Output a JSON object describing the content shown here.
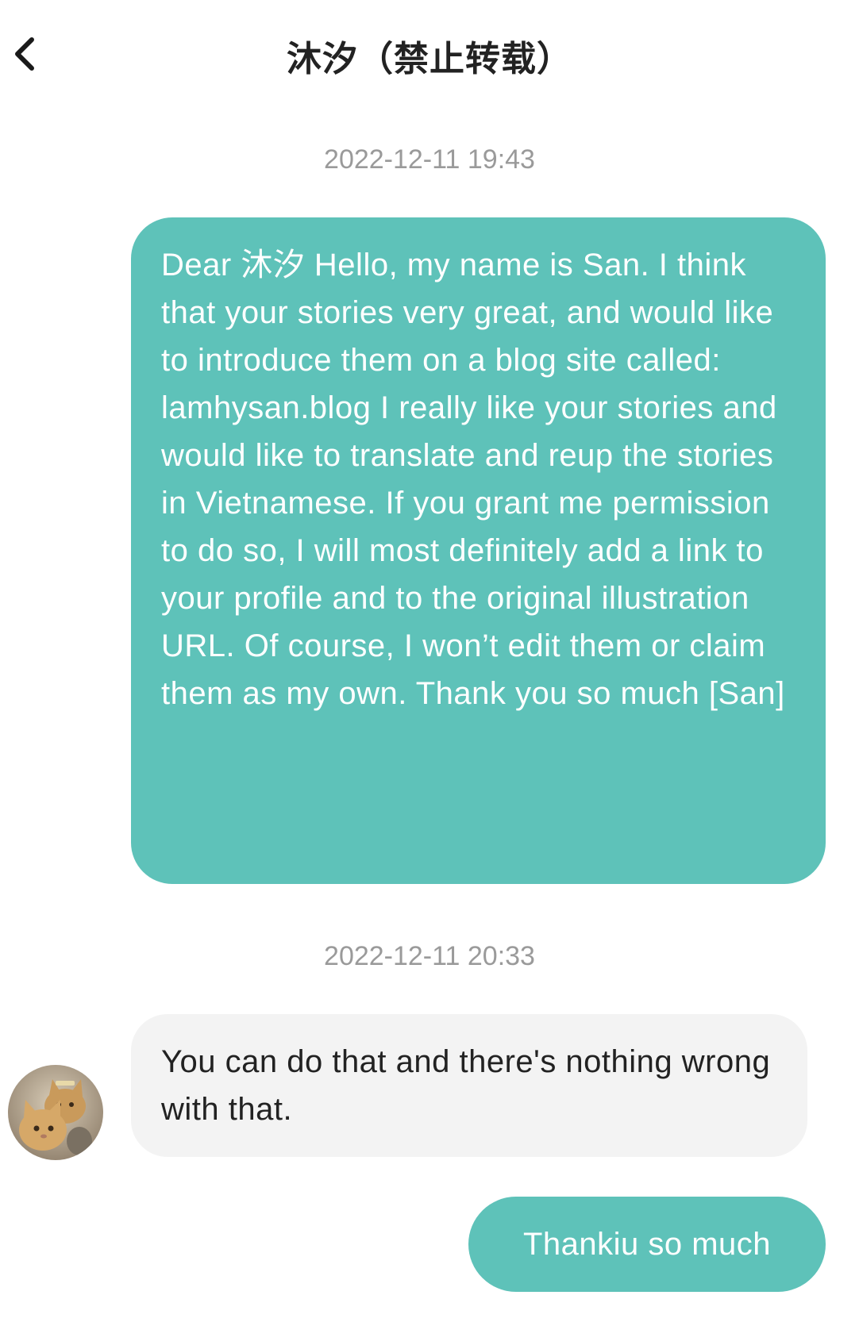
{
  "header": {
    "back_icon": "chevron-left-icon",
    "title": "沐汐（禁止转载）"
  },
  "conversation": {
    "timestamps": [
      "2022-12-11 19:43",
      "2022-12-11 20:33"
    ],
    "messages": [
      {
        "direction": "outgoing",
        "text": "Dear 沐汐 Hello, my name is San. I think that your stories very great, and would like to introduce them on a blog site called: lamhysan.blog I really like your stories and would like to translate and reup the stories in Vietnamese. If you grant me permission to do so, I will most definitely add a link to your profile and to the original illustration URL. Of course, I won’t edit them or claim them as my own. Thank you so much [San]"
      },
      {
        "direction": "incoming",
        "text": "You can do that and there's nothing wrong with that."
      },
      {
        "direction": "outgoing",
        "text": "Thankiu so much"
      }
    ]
  },
  "colors": {
    "outgoing_bubble": "#5ec2b9",
    "incoming_bubble": "#f3f3f3",
    "timestamp_text": "#9a9a9a",
    "title_text": "#222222"
  }
}
